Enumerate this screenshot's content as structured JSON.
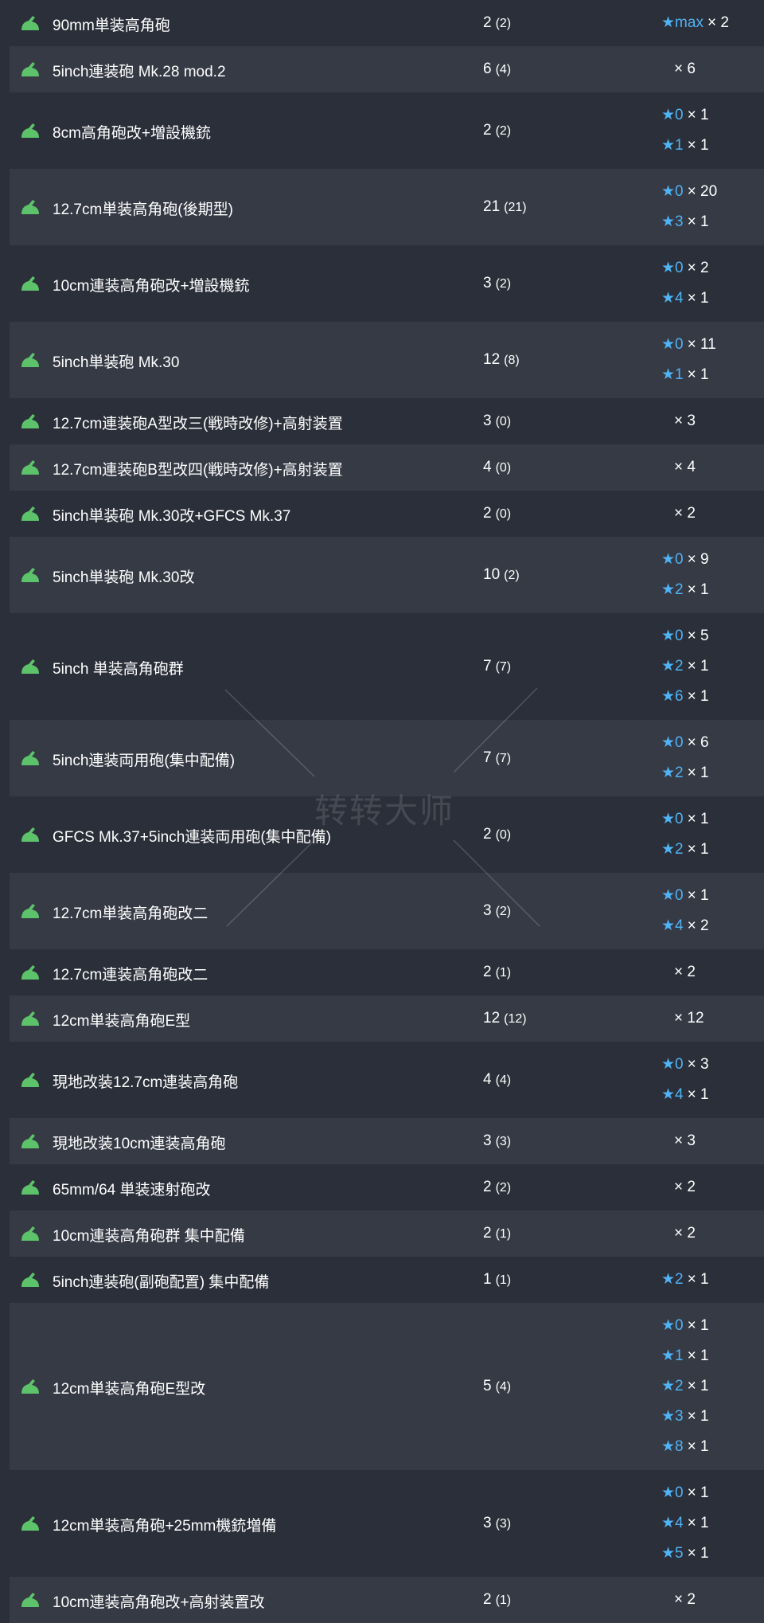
{
  "watermark": "转转大师",
  "colors": {
    "row_dark": "#2b2f39",
    "row_light": "#363a45",
    "star": "#4fb3f5",
    "icon_green": "#5cc36a",
    "text": "#ffffff"
  },
  "rows": [
    {
      "name": "90mm単装高角砲",
      "count": "2",
      "paren": "(2)",
      "improvements": [
        {
          "level": "max",
          "mult": "× 2"
        }
      ]
    },
    {
      "name": "5inch連装砲 Mk.28 mod.2",
      "count": "6",
      "paren": "(4)",
      "improvements": [
        {
          "level": "",
          "mult": "× 6"
        }
      ]
    },
    {
      "name": "8cm高角砲改+増設機銃",
      "count": "2",
      "paren": "(2)",
      "improvements": [
        {
          "level": "0",
          "mult": "× 1"
        },
        {
          "level": "1",
          "mult": "× 1"
        }
      ]
    },
    {
      "name": "12.7cm単装高角砲(後期型)",
      "count": "21",
      "paren": "(21)",
      "improvements": [
        {
          "level": "0",
          "mult": "× 20"
        },
        {
          "level": "3",
          "mult": "× 1"
        }
      ]
    },
    {
      "name": "10cm連装高角砲改+増設機銃",
      "count": "3",
      "paren": "(2)",
      "improvements": [
        {
          "level": "0",
          "mult": "× 2"
        },
        {
          "level": "4",
          "mult": "× 1"
        }
      ]
    },
    {
      "name": "5inch単装砲 Mk.30",
      "count": "12",
      "paren": "(8)",
      "improvements": [
        {
          "level": "0",
          "mult": "× 11"
        },
        {
          "level": "1",
          "mult": "× 1"
        }
      ]
    },
    {
      "name": "12.7cm連装砲A型改三(戦時改修)+高射装置",
      "count": "3",
      "paren": "(0)",
      "improvements": [
        {
          "level": "",
          "mult": "× 3"
        }
      ]
    },
    {
      "name": "12.7cm連装砲B型改四(戦時改修)+高射装置",
      "count": "4",
      "paren": "(0)",
      "improvements": [
        {
          "level": "",
          "mult": "× 4"
        }
      ]
    },
    {
      "name": "5inch単装砲 Mk.30改+GFCS Mk.37",
      "count": "2",
      "paren": "(0)",
      "improvements": [
        {
          "level": "",
          "mult": "× 2"
        }
      ]
    },
    {
      "name": "5inch単装砲 Mk.30改",
      "count": "10",
      "paren": "(2)",
      "improvements": [
        {
          "level": "0",
          "mult": "× 9"
        },
        {
          "level": "2",
          "mult": "× 1"
        }
      ]
    },
    {
      "name": "5inch 単装高角砲群",
      "count": "7",
      "paren": "(7)",
      "improvements": [
        {
          "level": "0",
          "mult": "× 5"
        },
        {
          "level": "2",
          "mult": "× 1"
        },
        {
          "level": "6",
          "mult": "× 1"
        }
      ]
    },
    {
      "name": "5inch連装両用砲(集中配備)",
      "count": "7",
      "paren": "(7)",
      "improvements": [
        {
          "level": "0",
          "mult": "× 6"
        },
        {
          "level": "2",
          "mult": "× 1"
        }
      ]
    },
    {
      "name": "GFCS Mk.37+5inch連装両用砲(集中配備)",
      "count": "2",
      "paren": "(0)",
      "improvements": [
        {
          "level": "0",
          "mult": "× 1"
        },
        {
          "level": "2",
          "mult": "× 1"
        }
      ]
    },
    {
      "name": "12.7cm単装高角砲改二",
      "count": "3",
      "paren": "(2)",
      "improvements": [
        {
          "level": "0",
          "mult": "× 1"
        },
        {
          "level": "4",
          "mult": "× 2"
        }
      ]
    },
    {
      "name": "12.7cm連装高角砲改二",
      "count": "2",
      "paren": "(1)",
      "improvements": [
        {
          "level": "",
          "mult": "× 2"
        }
      ]
    },
    {
      "name": "12cm単装高角砲E型",
      "count": "12",
      "paren": "(12)",
      "improvements": [
        {
          "level": "",
          "mult": "× 12"
        }
      ]
    },
    {
      "name": "現地改装12.7cm連装高角砲",
      "count": "4",
      "paren": "(4)",
      "improvements": [
        {
          "level": "0",
          "mult": "× 3"
        },
        {
          "level": "4",
          "mult": "× 1"
        }
      ]
    },
    {
      "name": "現地改装10cm連装高角砲",
      "count": "3",
      "paren": "(3)",
      "improvements": [
        {
          "level": "",
          "mult": "× 3"
        }
      ]
    },
    {
      "name": "65mm/64 単装速射砲改",
      "count": "2",
      "paren": "(2)",
      "improvements": [
        {
          "level": "",
          "mult": "× 2"
        }
      ]
    },
    {
      "name": "10cm連装高角砲群 集中配備",
      "count": "2",
      "paren": "(1)",
      "improvements": [
        {
          "level": "",
          "mult": "× 2"
        }
      ]
    },
    {
      "name": "5inch連装砲(副砲配置) 集中配備",
      "count": "1",
      "paren": "(1)",
      "improvements": [
        {
          "level": "2",
          "mult": "× 1"
        }
      ]
    },
    {
      "name": "12cm単装高角砲E型改",
      "count": "5",
      "paren": "(4)",
      "improvements": [
        {
          "level": "0",
          "mult": "× 1"
        },
        {
          "level": "1",
          "mult": "× 1"
        },
        {
          "level": "2",
          "mult": "× 1"
        },
        {
          "level": "3",
          "mult": "× 1"
        },
        {
          "level": "8",
          "mult": "× 1"
        }
      ]
    },
    {
      "name": "12cm単装高角砲+25mm機銃増備",
      "count": "3",
      "paren": "(3)",
      "improvements": [
        {
          "level": "0",
          "mult": "× 1"
        },
        {
          "level": "4",
          "mult": "× 1"
        },
        {
          "level": "5",
          "mult": "× 1"
        }
      ]
    },
    {
      "name": "10cm連装高角砲改+高射装置改",
      "count": "2",
      "paren": "(1)",
      "improvements": [
        {
          "level": "",
          "mult": "× 2"
        }
      ]
    }
  ]
}
